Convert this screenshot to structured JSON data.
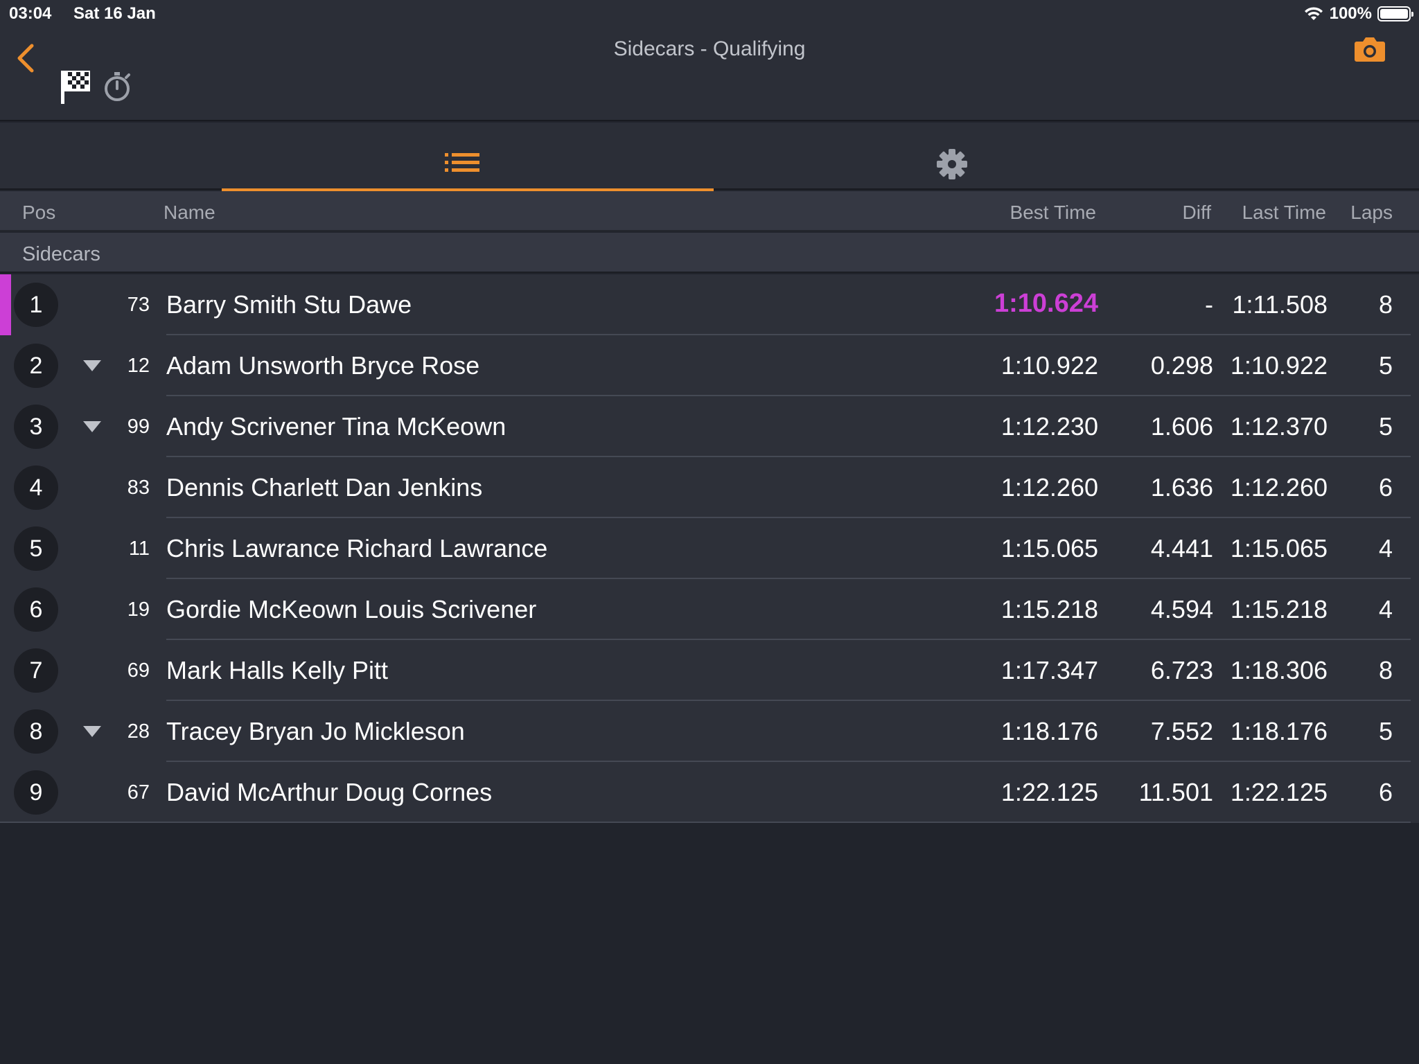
{
  "status": {
    "time": "03:04",
    "date": "Sat 16 Jan",
    "battery": "100%"
  },
  "title": "Sidecars - Qualifying",
  "icons": {
    "back": "chevron-left-icon",
    "flag": "checkered-flag-icon",
    "stopwatch": "stopwatch-icon",
    "camera": "camera-icon",
    "list": "list-icon",
    "settings": "gear-icon"
  },
  "colors": {
    "accent": "#ee8f2d",
    "fastest": "#cc3fd6"
  },
  "tabs": [
    {
      "icon": "list-icon",
      "active": true
    },
    {
      "icon": "gear-icon",
      "active": false
    }
  ],
  "columns": {
    "pos": "Pos",
    "name": "Name",
    "best": "Best Time",
    "diff": "Diff",
    "last": "Last Time",
    "laps": "Laps"
  },
  "group": "Sidecars",
  "rows": [
    {
      "pos": "1",
      "num": "73",
      "name": "Barry Smith Stu Dawe",
      "best": "1:10.624",
      "diff": "-",
      "last": "1:11.508",
      "laps": "8",
      "fastest": true,
      "down": false
    },
    {
      "pos": "2",
      "num": "12",
      "name": "Adam Unsworth Bryce Rose",
      "best": "1:10.922",
      "diff": "0.298",
      "last": "1:10.922",
      "laps": "5",
      "fastest": false,
      "down": true
    },
    {
      "pos": "3",
      "num": "99",
      "name": "Andy Scrivener Tina McKeown",
      "best": "1:12.230",
      "diff": "1.606",
      "last": "1:12.370",
      "laps": "5",
      "fastest": false,
      "down": true
    },
    {
      "pos": "4",
      "num": "83",
      "name": "Dennis Charlett Dan Jenkins",
      "best": "1:12.260",
      "diff": "1.636",
      "last": "1:12.260",
      "laps": "6",
      "fastest": false,
      "down": false
    },
    {
      "pos": "5",
      "num": "11",
      "name": "Chris Lawrance Richard Lawrance",
      "best": "1:15.065",
      "diff": "4.441",
      "last": "1:15.065",
      "laps": "4",
      "fastest": false,
      "down": false
    },
    {
      "pos": "6",
      "num": "19",
      "name": "Gordie McKeown Louis Scrivener",
      "best": "1:15.218",
      "diff": "4.594",
      "last": "1:15.218",
      "laps": "4",
      "fastest": false,
      "down": false
    },
    {
      "pos": "7",
      "num": "69",
      "name": "Mark Halls Kelly Pitt",
      "best": "1:17.347",
      "diff": "6.723",
      "last": "1:18.306",
      "laps": "8",
      "fastest": false,
      "down": false
    },
    {
      "pos": "8",
      "num": "28",
      "name": "Tracey Bryan Jo Mickleson",
      "best": "1:18.176",
      "diff": "7.552",
      "last": "1:18.176",
      "laps": "5",
      "fastest": false,
      "down": true
    },
    {
      "pos": "9",
      "num": "67",
      "name": "David McArthur Doug Cornes",
      "best": "1:22.125",
      "diff": "11.501",
      "last": "1:22.125",
      "laps": "6",
      "fastest": false,
      "down": false
    }
  ]
}
